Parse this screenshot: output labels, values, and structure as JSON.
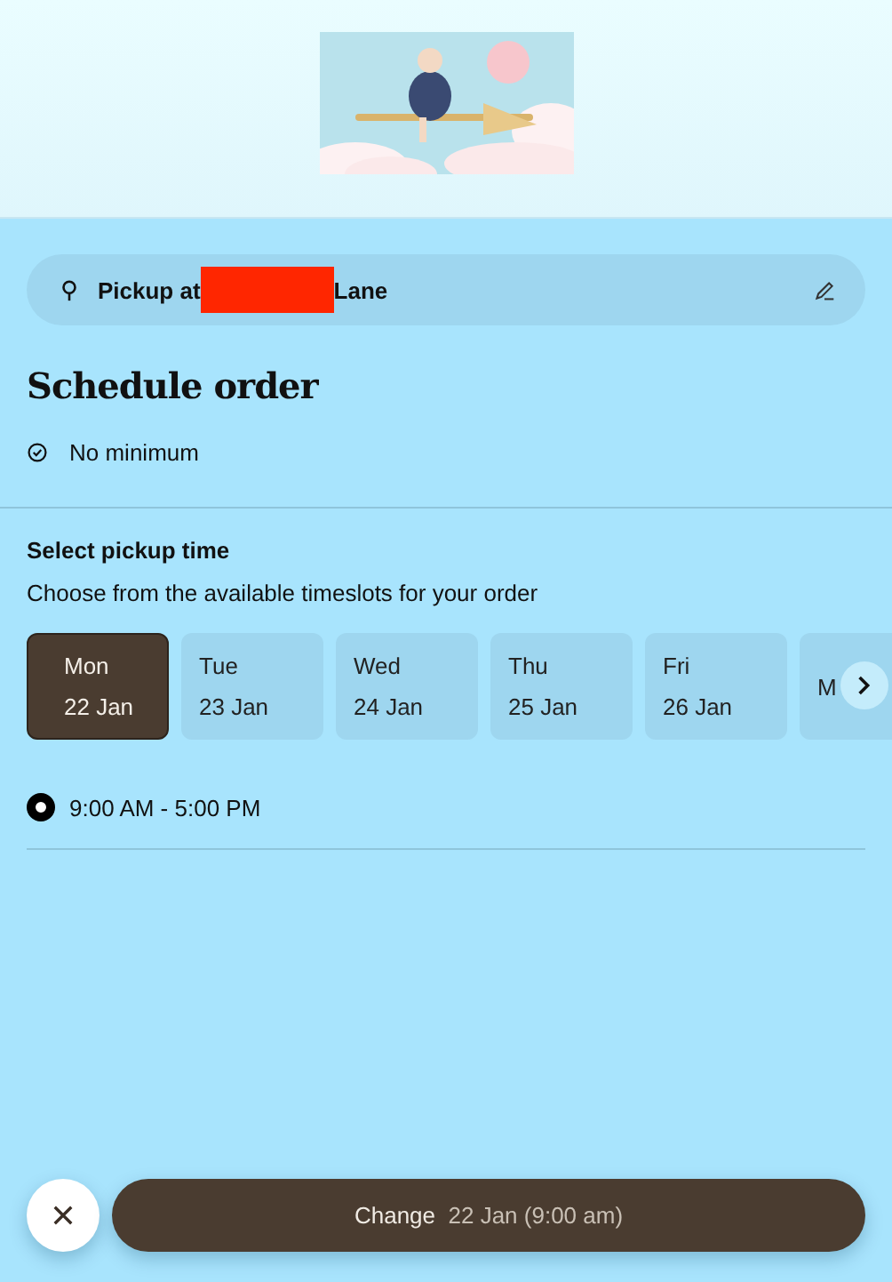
{
  "pickup": {
    "prefix": "Pickup at",
    "suffix": "Lane",
    "redacted": true
  },
  "title": "Schedule order",
  "minimum": "No minimum",
  "pickup_time": {
    "heading": "Select pickup time",
    "subtitle": "Choose from the available timeslots for your order",
    "days": [
      {
        "day": "Mon",
        "date": "22 Jan",
        "selected": true
      },
      {
        "day": "Tue",
        "date": "23 Jan",
        "selected": false
      },
      {
        "day": "Wed",
        "date": "24 Jan",
        "selected": false
      },
      {
        "day": "Thu",
        "date": "25 Jan",
        "selected": false
      },
      {
        "day": "Fri",
        "date": "26 Jan",
        "selected": false
      },
      {
        "day": "M",
        "selected": false
      }
    ],
    "timeslots": [
      {
        "label": "9:00 AM - 5:00 PM",
        "selected": true
      }
    ]
  },
  "footer": {
    "button_label": "Change",
    "button_detail": "22 Jan (9:00 am)"
  }
}
